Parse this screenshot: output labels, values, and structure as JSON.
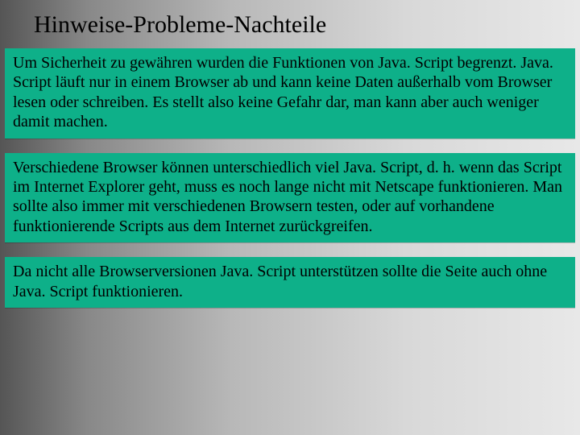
{
  "title": "Hinweise-Probleme-Nachteile",
  "boxes": [
    {
      "text": "Um Sicherheit zu gewähren wurden die Funktionen von Java. Script begrenzt.\nJava. Script läuft nur in einem Browser ab und kann keine Daten außerhalb vom Browser lesen oder schreiben.\nEs stellt also keine Gefahr dar, man kann aber auch weniger damit machen."
    },
    {
      "text": "Verschiedene Browser können unterschiedlich viel Java. Script, d. h. wenn das Script im Internet Explorer geht, muss es noch lange nicht mit Netscape funktionieren. Man sollte also immer mit verschiedenen Browsern testen, oder auf vorhandene funktionierende Scripts aus dem Internet zurückgreifen."
    },
    {
      "text": "Da nicht alle Browserversionen Java. Script unterstützen sollte die Seite auch ohne Java. Script funktionieren."
    }
  ]
}
